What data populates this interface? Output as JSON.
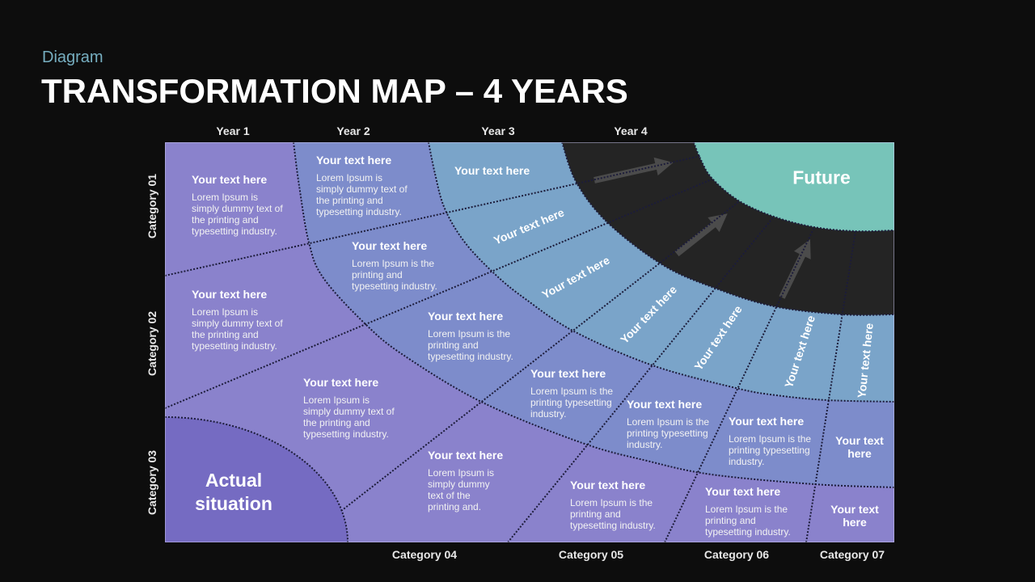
{
  "header": {
    "subtitle": "Diagram",
    "title": "TRANSFORMATION MAP – 4 YEARS"
  },
  "axes": {
    "years": [
      "Year 1",
      "Year 2",
      "Year 3",
      "Year 4"
    ],
    "row_categories": [
      "Category 01",
      "Category 02",
      "Category 03"
    ],
    "column_categories": [
      "Category 04",
      "Category 05",
      "Category 06",
      "Category 07"
    ]
  },
  "zones": {
    "future": "Future",
    "actual": "Actual\nsituation"
  },
  "cells": [
    {
      "heading": "Your text here",
      "body": "Lorem Ipsum is\nsimply dummy text of\nthe printing and\ntypesetting industry."
    },
    {
      "heading": "Your text here",
      "body": "Lorem Ipsum is\nsimply dummy text of\nthe printing and\ntypesetting industry."
    },
    {
      "heading": "Your text here"
    },
    {
      "heading": "Your text here",
      "body": "Lorem Ipsum is the\nprinting and\ntypesetting industry."
    },
    {
      "heading": "Your text here",
      "body": "Lorem Ipsum is\nsimply dummy text of\nthe printing and\ntypesetting industry."
    },
    {
      "heading": "Your text here",
      "body": "Lorem Ipsum is the\nprinting and\ntypesetting industry."
    },
    {
      "heading": "Your text here",
      "body": "Lorem Ipsum is\nsimply dummy text of\nthe printing and\ntypesetting industry."
    },
    {
      "heading": "Your text here",
      "body": "Lorem Ipsum is the\nprinting typesetting\nindustry."
    },
    {
      "heading": "Your text here",
      "body": "Lorem Ipsum is the\nprinting typesetting\nindustry."
    },
    {
      "heading": "Your text here",
      "body": "Lorem Ipsum is the\nprinting typesetting\nindustry."
    },
    {
      "heading": "Your text here",
      "body": "Lorem Ipsum is\nsimply dummy\ntext of the\nprinting and."
    },
    {
      "heading": "Your text here",
      "body": "Lorem Ipsum is the\nprinting and\ntypesetting industry."
    },
    {
      "heading": "Your text here",
      "body": "Lorem Ipsum is the\nprinting and\ntypesetting industry."
    }
  ],
  "short_cells": [
    "Your text\nhere",
    "Your text\nhere"
  ],
  "ring_labels": [
    "Your text here",
    "Your text here",
    "Your text here",
    "Your text here",
    "Your text here",
    "Your text here"
  ],
  "colors": {
    "background": "#0d0d0d",
    "subtitle": "#76aec0",
    "year1_region": "#8a82cc",
    "year2_region": "#7d8ccb",
    "year3_region": "#7aa4c9",
    "year4_ring": "#242424",
    "future": "#77c4b9",
    "actual_situation": "#756bc2",
    "arrow": "#4b4b4b",
    "divider": "#1c1c3a",
    "border": "#c9c6ee"
  }
}
